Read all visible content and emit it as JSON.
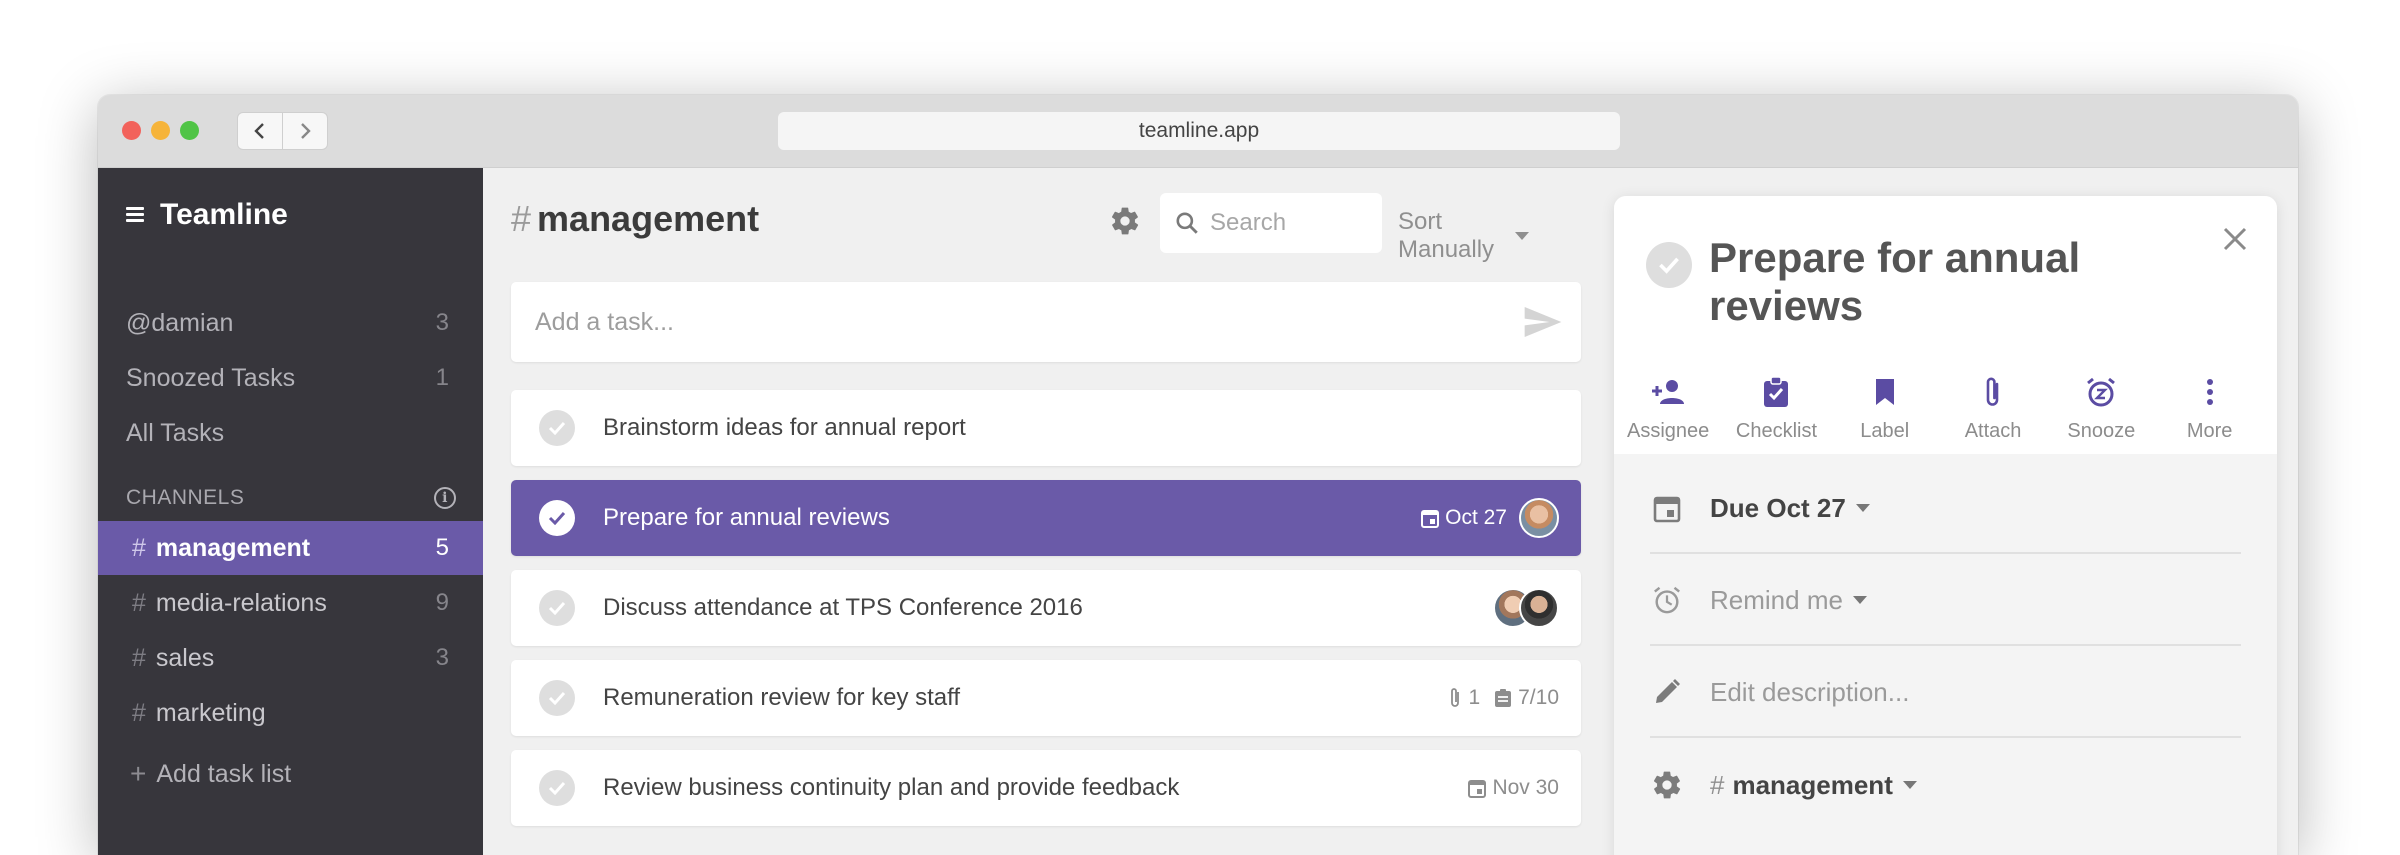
{
  "browser": {
    "url": "teamline.app"
  },
  "sidebar": {
    "app_name": "Teamline",
    "items": [
      {
        "label": "@damian",
        "count": "3"
      },
      {
        "label": "Snoozed Tasks",
        "count": "1"
      },
      {
        "label": "All Tasks",
        "count": ""
      }
    ],
    "channels_heading": "CHANNELS",
    "channels": [
      {
        "name": "management",
        "count": "5",
        "active": true
      },
      {
        "name": "media-relations",
        "count": "9",
        "active": false
      },
      {
        "name": "sales",
        "count": "3",
        "active": false
      },
      {
        "name": "marketing",
        "count": "",
        "active": false
      }
    ],
    "hash": "#",
    "add_list_label": "Add task list"
  },
  "main": {
    "list_name": "management",
    "hash": "#",
    "search_placeholder": "Search",
    "sort_label": "Sort Manually",
    "add_task_placeholder": "Add a task...",
    "tasks": [
      {
        "title": "Brainstorm ideas for annual report"
      },
      {
        "title": "Prepare for annual reviews",
        "due": "Oct 27",
        "selected": true
      },
      {
        "title": "Discuss attendance at TPS Conference 2016"
      },
      {
        "title": "Remuneration review for key staff",
        "attachments": "1",
        "checklist": "7/10"
      },
      {
        "title": "Review business continuity plan and provide feedback",
        "due": "Nov 30"
      }
    ]
  },
  "detail": {
    "title": "Prepare for annual reviews",
    "actions": [
      {
        "label": "Assignee",
        "icon": "add-person-icon"
      },
      {
        "label": "Checklist",
        "icon": "checklist-icon"
      },
      {
        "label": "Label",
        "icon": "bookmark-icon"
      },
      {
        "label": "Attach",
        "icon": "paperclip-icon"
      },
      {
        "label": "Snooze",
        "icon": "alarm-snooze-icon"
      },
      {
        "label": "More",
        "icon": "more-vertical-icon"
      }
    ],
    "due_label": "Due Oct 27",
    "remind_label": "Remind me",
    "description_placeholder": "Edit description...",
    "list_label": "management"
  },
  "colors": {
    "accent": "#6a5aa8",
    "sidebar_bg": "#37363c",
    "icon_purple": "#5b4ca3"
  }
}
